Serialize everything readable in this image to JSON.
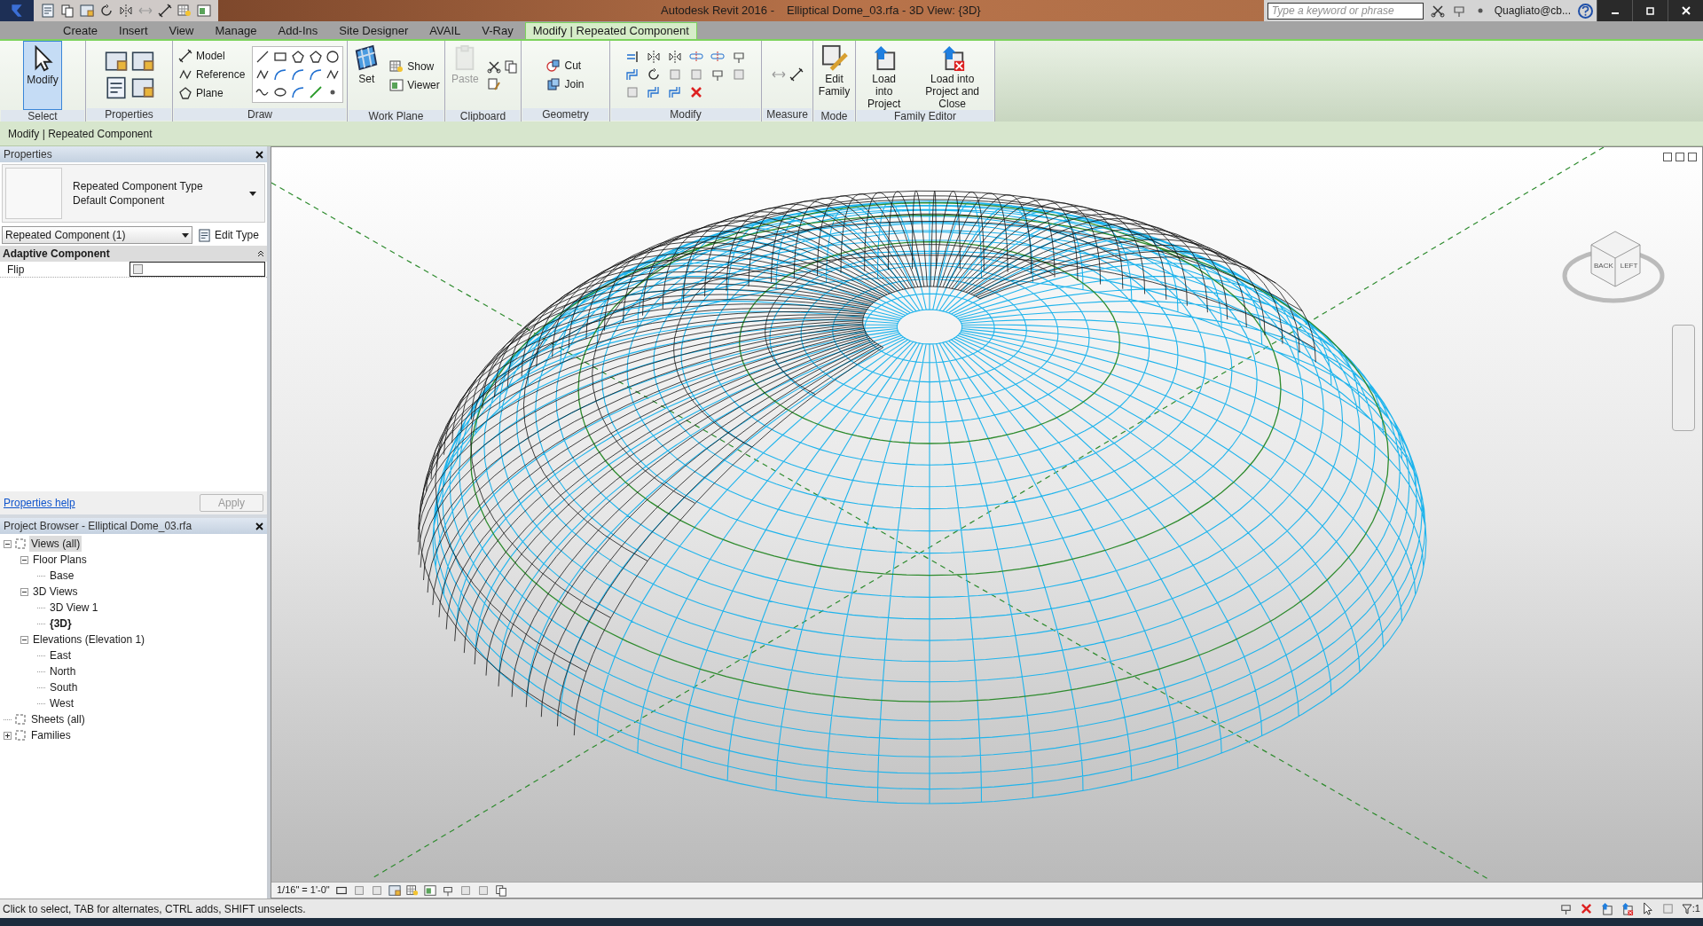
{
  "title_bar": {
    "app": "Autodesk Revit 2016 -",
    "document": "Elliptical Dome_03.rfa - 3D View: {3D}",
    "search": {
      "placeholder": "Type a keyword or phrase"
    },
    "user": "Quagliato@cb..."
  },
  "tabs": [
    {
      "label": "Create",
      "selected": false
    },
    {
      "label": "Insert",
      "selected": false
    },
    {
      "label": "View",
      "selected": false
    },
    {
      "label": "Manage",
      "selected": false
    },
    {
      "label": "Add-Ins",
      "selected": false
    },
    {
      "label": "Site Designer",
      "selected": false
    },
    {
      "label": "AVAIL",
      "selected": false
    },
    {
      "label": "V-Ray",
      "selected": false
    },
    {
      "label": "Modify | Repeated Component",
      "selected": true
    }
  ],
  "ribbon_panels": [
    {
      "label": "Select",
      "buttons": [
        {
          "label": "Modify",
          "kind": "large",
          "disabled": false,
          "active": true
        }
      ]
    },
    {
      "label": "Properties"
    },
    {
      "label": "Draw",
      "buttons": [
        {
          "label": "Model",
          "kind": "small",
          "disabled": false,
          "active": false
        },
        {
          "label": "Reference",
          "kind": "small",
          "disabled": false,
          "active": false
        },
        {
          "label": "Plane",
          "kind": "small",
          "disabled": false,
          "active": false
        }
      ]
    },
    {
      "label": "Work Plane",
      "buttons": [
        {
          "label": "Set",
          "kind": "large",
          "disabled": false,
          "active": false
        },
        {
          "label": "Show",
          "kind": "small",
          "disabled": false,
          "active": false
        },
        {
          "label": "Viewer",
          "kind": "small",
          "disabled": false,
          "active": false
        }
      ]
    },
    {
      "label": "Clipboard",
      "buttons": [
        {
          "label": "Paste",
          "kind": "large",
          "disabled": true,
          "active": false
        }
      ]
    },
    {
      "label": "Geometry",
      "buttons": [
        {
          "label": "Cut",
          "kind": "small",
          "disabled": false,
          "active": false
        },
        {
          "label": "Join",
          "kind": "small",
          "disabled": false,
          "active": false
        }
      ]
    },
    {
      "label": "Modify"
    },
    {
      "label": "Measure"
    },
    {
      "label": "Mode",
      "buttons": [
        {
          "label": "Edit Family",
          "kind": "large",
          "disabled": false,
          "active": false
        }
      ]
    },
    {
      "label": "Family Editor",
      "buttons": [
        {
          "label": "Load into Project",
          "kind": "large",
          "disabled": false,
          "active": false
        },
        {
          "label": "Load into Project and Close",
          "kind": "large",
          "disabled": false,
          "active": false
        }
      ]
    }
  ],
  "options_bar": "Modify | Repeated Component",
  "properties": {
    "title": "Properties",
    "type_lines": [
      "Repeated Component Type",
      "Default Component"
    ],
    "instance_selector": "Repeated Component (1)",
    "edit_type": "Edit Type",
    "group": "Adaptive Component",
    "params": [
      {
        "name": "Flip",
        "checked": false
      }
    ],
    "help": "Properties help",
    "apply": {
      "label": "Apply",
      "disabled": true
    }
  },
  "project_browser": {
    "title": "Project Browser - Elliptical Dome_03.rfa",
    "tree": [
      {
        "label": "Views (all)",
        "expanded": true,
        "selected": true,
        "open": false,
        "children": [
          {
            "label": "Floor Plans",
            "expanded": true,
            "selected": false,
            "open": false,
            "children": [
              {
                "label": "Base",
                "selected": false,
                "open": false
              }
            ]
          },
          {
            "label": "3D Views",
            "expanded": true,
            "selected": false,
            "open": false,
            "children": [
              {
                "label": "3D View 1",
                "selected": false,
                "open": false
              },
              {
                "label": "{3D}",
                "selected": false,
                "open": true
              }
            ]
          },
          {
            "label": "Elevations (Elevation 1)",
            "expanded": true,
            "selected": false,
            "open": false,
            "children": [
              {
                "label": "East",
                "selected": false,
                "open": false
              },
              {
                "label": "North",
                "selected": false,
                "open": false
              },
              {
                "label": "South",
                "selected": false,
                "open": false
              },
              {
                "label": "West",
                "selected": false,
                "open": false
              }
            ]
          }
        ]
      },
      {
        "label": "Sheets (all)",
        "selected": false,
        "open": false
      },
      {
        "label": "Families",
        "expanded": false,
        "selected": false,
        "open": false
      }
    ]
  },
  "view_cube": {
    "faces": [
      "BACK",
      "LEFT"
    ]
  },
  "view_bar": {
    "scale": "1/16\" = 1'-0\""
  },
  "status_bar": {
    "message": "Click to select, TAB for alternates, CTRL adds, SHIFT unselects.",
    "filter_count": ":1"
  }
}
